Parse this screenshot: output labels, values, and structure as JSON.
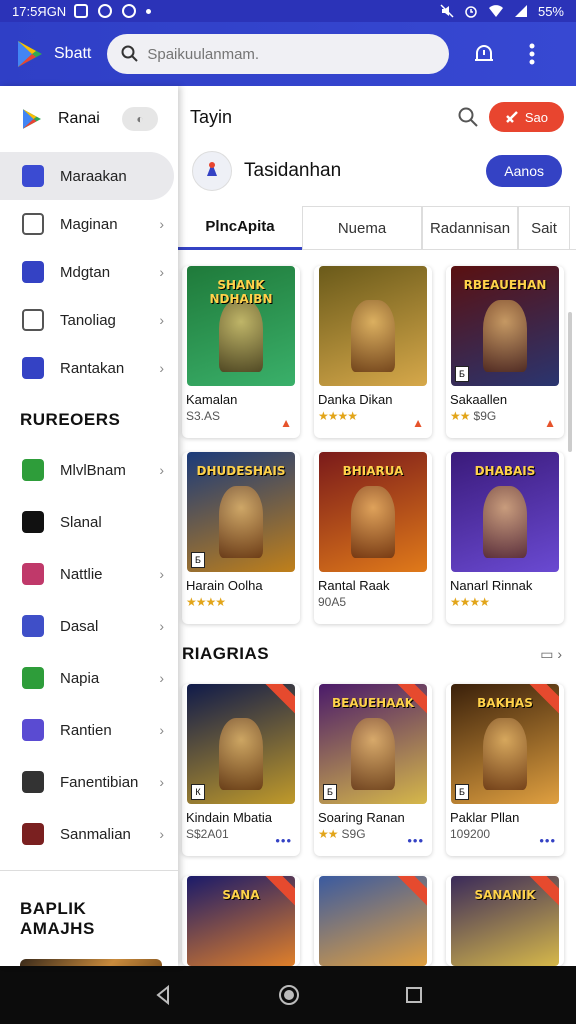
{
  "status_bar": {
    "time": "17:5ЯGN",
    "battery": "55%"
  },
  "app_bar": {
    "app_name": "Sbatt",
    "search_placeholder": "Spaikuulanmam."
  },
  "drawer": {
    "header_title": "Ranai",
    "items": [
      {
        "label": "Maraakan",
        "active": true,
        "chevron": false,
        "color": "#3b4bd2"
      },
      {
        "label": "Maginan",
        "active": false,
        "chevron": true,
        "color": "#ffffff"
      },
      {
        "label": "Mdgtan",
        "active": false,
        "chevron": true,
        "color": "#3442c4"
      },
      {
        "label": "Tanoliag",
        "active": false,
        "chevron": true,
        "color": "#ffffff"
      },
      {
        "label": "Rantakan",
        "active": false,
        "chevron": true,
        "color": "#3442c4"
      }
    ],
    "section_title": "RUREOERS",
    "section_items": [
      {
        "label": "MlvlBnam",
        "chevron": true,
        "color": "#2e9d3a"
      },
      {
        "label": "Slanal",
        "chevron": false,
        "color": "#111111"
      },
      {
        "label": "Nattlie",
        "chevron": true,
        "color": "#c0396a"
      },
      {
        "label": "Dasal",
        "chevron": true,
        "color": "#3f4fc8"
      },
      {
        "label": "Napia",
        "chevron": true,
        "color": "#2e9d3a"
      },
      {
        "label": "Rantien",
        "chevron": true,
        "color": "#5a4bd2"
      },
      {
        "label": "Fanentibian",
        "chevron": true,
        "color": "#333333"
      },
      {
        "label": "Sanmalian",
        "chevron": true,
        "color": "#7a2020"
      }
    ],
    "footer_title": "BAPLIK AMAJHS"
  },
  "main": {
    "title": "Tayin",
    "sign_button": "Sao",
    "account_name": "Tasidanhan",
    "account_button": "Aanos",
    "tabs": [
      "PlncApita",
      "Nuema",
      "Radannisan",
      "Sait"
    ],
    "cards_top": [
      {
        "name": "Kamalan",
        "meta": "S3.AS",
        "art_text": "SHANK NDHAIBN",
        "c1": "#1f7a3a",
        "c2": "#3ab06a",
        "badge": "",
        "action": "▲",
        "stars": ""
      },
      {
        "name": "Danka Dikan",
        "meta": "",
        "art_text": "",
        "c1": "#6a5a1a",
        "c2": "#d6a84a",
        "badge": "",
        "action": "▲",
        "stars": "★★★★"
      },
      {
        "name": "Sakaallen",
        "meta": "$9G",
        "art_text": "RBEAUEHAN",
        "c1": "#5a1010",
        "c2": "#2a3570",
        "badge": "Б",
        "action": "▲",
        "stars": "★★"
      },
      {
        "name": "Harain Oolha",
        "meta": "",
        "art_text": "DHUDESHAIS",
        "c1": "#1a3a7a",
        "c2": "#c0801a",
        "badge": "Б",
        "action": "",
        "stars": "★★★★"
      },
      {
        "name": "Rantal Raak",
        "meta": "90A5",
        "art_text": "BHIARUA",
        "c1": "#7a1a1a",
        "c2": "#e07a1a",
        "badge": "",
        "action": "",
        "stars": ""
      },
      {
        "name": "Nanarl Rinnak",
        "meta": "",
        "art_text": "DHABAIS",
        "c1": "#3a1a7a",
        "c2": "#6a4ad2",
        "badge": "",
        "action": "",
        "stars": "★★★★"
      }
    ],
    "section_title": "RIAGRIAS",
    "cards_bottom": [
      {
        "name": "Kindain Mbatia",
        "meta": "S$2A01",
        "art_text": "",
        "c1": "#0f1a4a",
        "c2": "#c09a2a",
        "badge": "К",
        "stars": ""
      },
      {
        "name": "Soaring Ranan",
        "meta": "S9G",
        "art_text": "BEAUEHAAK",
        "c1": "#4a1a6a",
        "c2": "#d6b84a",
        "badge": "Б",
        "stars": "★★"
      },
      {
        "name": "Paklar Pllan",
        "meta": "109200",
        "art_text": "BAKHAS",
        "c1": "#3a200a",
        "c2": "#e0a040",
        "badge": "Б",
        "stars": ""
      }
    ],
    "partial_row_art": [
      "SANA",
      "",
      "SANANIK"
    ]
  }
}
